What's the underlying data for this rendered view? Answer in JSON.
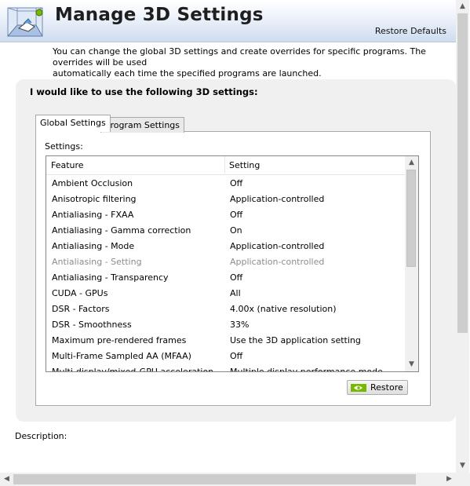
{
  "header": {
    "title": "Manage 3D Settings",
    "restore_defaults": "Restore Defaults",
    "logo_icon": "3d-cube-scene-icon"
  },
  "intro_text": "You can change the global 3D settings and create overrides for specific programs. The overrides will be used\nautomatically each time the specified programs are launched.",
  "panel": {
    "heading": "I would like to use the following 3D settings:",
    "tabs": [
      {
        "label": "Global Settings",
        "active": true
      },
      {
        "label": "Program Settings",
        "active": false
      }
    ],
    "settings_label": "Settings:",
    "columns": [
      "Feature",
      "Setting"
    ],
    "rows": [
      {
        "feature": "Ambient Occlusion",
        "setting": "Off",
        "disabled": false
      },
      {
        "feature": "Anisotropic filtering",
        "setting": "Application-controlled",
        "disabled": false
      },
      {
        "feature": "Antialiasing - FXAA",
        "setting": "Off",
        "disabled": false
      },
      {
        "feature": "Antialiasing - Gamma correction",
        "setting": "On",
        "disabled": false
      },
      {
        "feature": "Antialiasing - Mode",
        "setting": "Application-controlled",
        "disabled": false
      },
      {
        "feature": "Antialiasing - Setting",
        "setting": "Application-controlled",
        "disabled": true
      },
      {
        "feature": "Antialiasing - Transparency",
        "setting": "Off",
        "disabled": false
      },
      {
        "feature": "CUDA - GPUs",
        "setting": "All",
        "disabled": false
      },
      {
        "feature": "DSR - Factors",
        "setting": "4.00x (native resolution)",
        "disabled": false
      },
      {
        "feature": "DSR - Smoothness",
        "setting": "33%",
        "disabled": false
      },
      {
        "feature": "Maximum pre-rendered frames",
        "setting": "Use the 3D application setting",
        "disabled": false
      },
      {
        "feature": "Multi-Frame Sampled AA (MFAA)",
        "setting": "Off",
        "disabled": false
      },
      {
        "feature": "Multi-display/mixed-GPU acceleration",
        "setting": "Multiple display performance mode",
        "disabled": false
      }
    ],
    "restore_button": "Restore"
  },
  "description_label": "Description:",
  "colors": {
    "header_gradient_end": "#cfdcef",
    "panel_bg": "#f0f0f0",
    "disabled_text": "#8c8c8c",
    "nvidia_green": "#76b900"
  },
  "icons": {
    "scroll_up": "▲",
    "scroll_down": "▼",
    "scroll_left": "◀",
    "scroll_right": "▶"
  }
}
